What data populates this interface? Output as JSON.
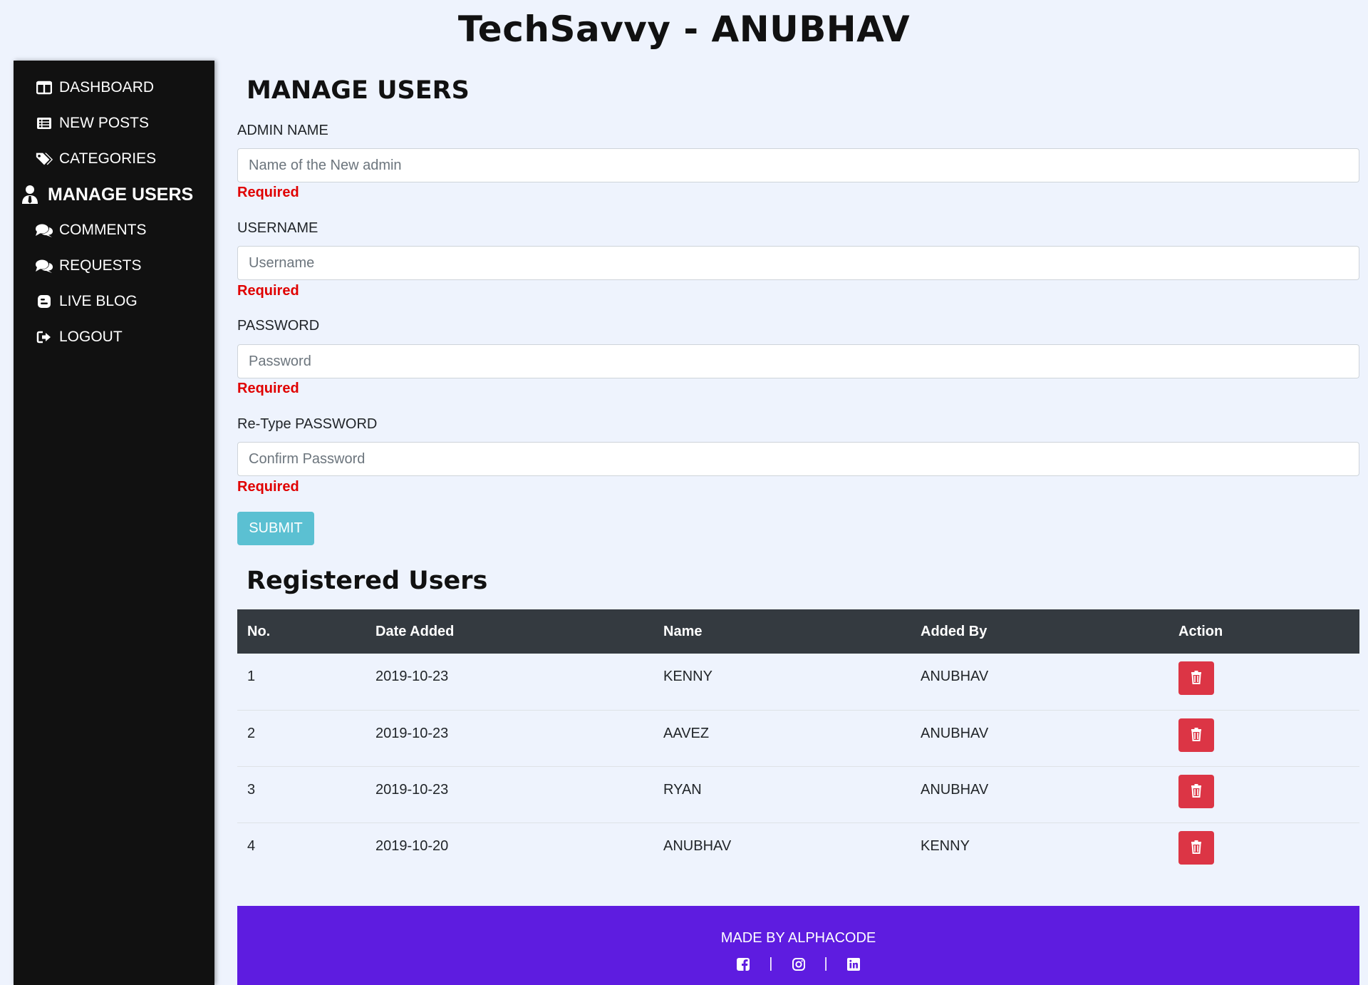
{
  "site": {
    "title": "TechSavvy - ANUBHAV"
  },
  "sidebar": {
    "items": [
      {
        "label": "DASHBOARD",
        "icon": "columns-icon"
      },
      {
        "label": "NEW POSTS",
        "icon": "list-icon"
      },
      {
        "label": "CATEGORIES",
        "icon": "tags-icon"
      },
      {
        "label": "MANAGE USERS",
        "icon": "user-tie-icon",
        "active": true
      },
      {
        "label": "COMMENTS",
        "icon": "comments-icon"
      },
      {
        "label": "REQUESTS",
        "icon": "comments-icon"
      },
      {
        "label": "LIVE BLOG",
        "icon": "blogger-icon"
      },
      {
        "label": "LOGOUT",
        "icon": "sign-out-icon"
      }
    ]
  },
  "form": {
    "title": "MANAGE USERS",
    "fields": [
      {
        "label": "ADMIN NAME",
        "placeholder": "Name of the New admin",
        "error": "Required"
      },
      {
        "label": "USERNAME",
        "placeholder": "Username",
        "error": "Required"
      },
      {
        "label": "PASSWORD",
        "placeholder": "Password",
        "error": "Required"
      },
      {
        "label": "Re-Type PASSWORD",
        "placeholder": "Confirm Password",
        "error": "Required"
      }
    ],
    "submit_label": "SUBMIT"
  },
  "users_table": {
    "title": "Registered Users",
    "columns": [
      "No.",
      "Date Added",
      "Name",
      "Added By",
      "Action"
    ],
    "rows": [
      {
        "no": "1",
        "date": "2019-10-23",
        "name": "KENNY",
        "added_by": "ANUBHAV"
      },
      {
        "no": "2",
        "date": "2019-10-23",
        "name": "AAVEZ",
        "added_by": "ANUBHAV"
      },
      {
        "no": "3",
        "date": "2019-10-23",
        "name": "RYAN",
        "added_by": "ANUBHAV"
      },
      {
        "no": "4",
        "date": "2019-10-20",
        "name": "ANUBHAV",
        "added_by": "KENNY"
      }
    ]
  },
  "footer": {
    "text": "MADE BY ALPHACODE",
    "separator": "|",
    "social": [
      "facebook-icon",
      "instagram-icon",
      "linkedin-icon"
    ]
  },
  "colors": {
    "page_bg": "#eef3fd",
    "sidebar_bg": "#111111",
    "table_header": "#343a40",
    "submit": "#5bc0d2",
    "delete": "#dc3545",
    "required": "#e00000",
    "footer_bg": "#5e1ce0"
  }
}
